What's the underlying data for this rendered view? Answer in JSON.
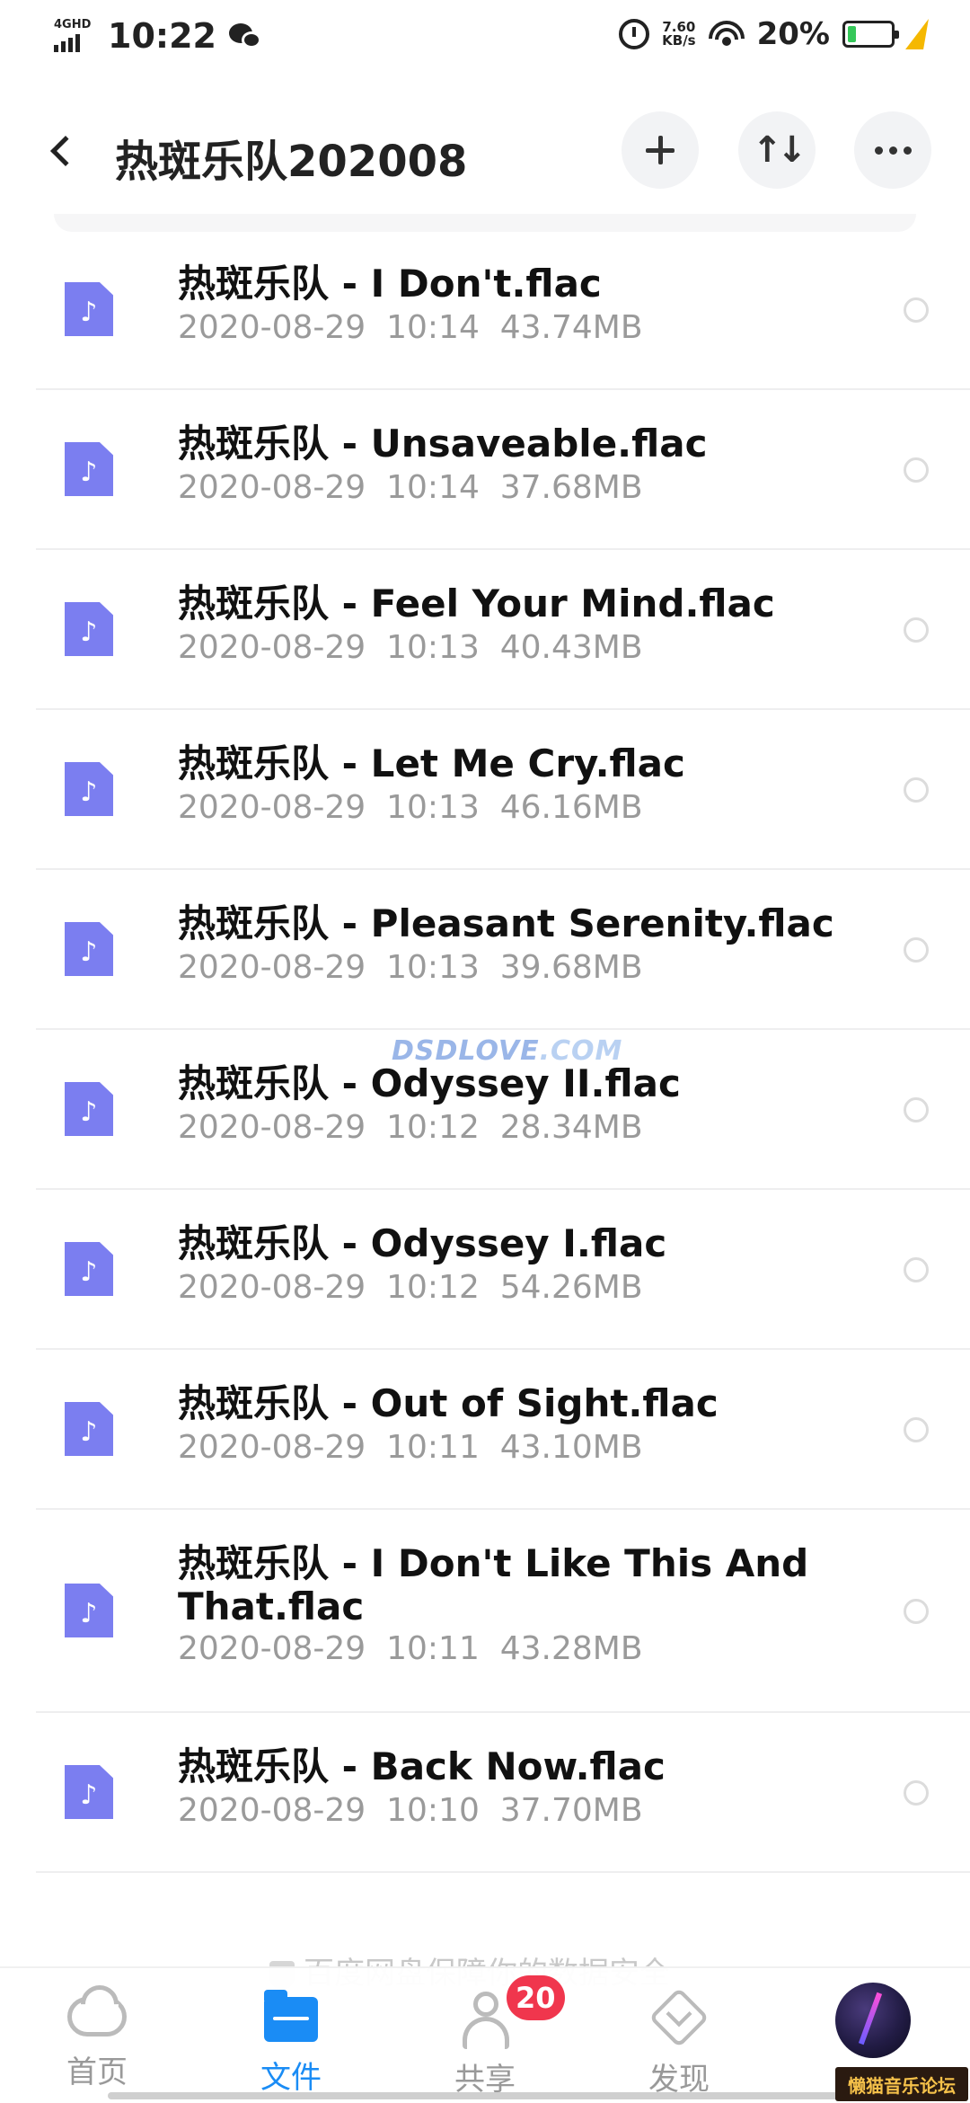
{
  "status_bar": {
    "network": "4GHD",
    "time": "10:22",
    "speed_value": "7.60",
    "speed_unit": "KB/s",
    "battery_percent": "20%",
    "battery_level": 0.2,
    "icons": [
      "wechat-icon",
      "alarm-icon",
      "wifi-icon",
      "battery-icon",
      "charging-icon"
    ]
  },
  "header": {
    "back_icon": "chevron-left-icon",
    "title": "热斑乐队202008",
    "add_icon": "plus-icon",
    "sort_icon": "sort-icon",
    "sort_glyph": "↑↓",
    "more_icon": "more-icon"
  },
  "files": [
    {
      "name": "热斑乐队 - I Don't.flac",
      "date": "2020-08-29",
      "time": "10:14",
      "size": "43.74MB"
    },
    {
      "name": "热斑乐队 - Unsaveable.flac",
      "date": "2020-08-29",
      "time": "10:14",
      "size": "37.68MB"
    },
    {
      "name": "热斑乐队 - Feel Your Mind.flac",
      "date": "2020-08-29",
      "time": "10:13",
      "size": "40.43MB"
    },
    {
      "name": "热斑乐队 - Let Me Cry.flac",
      "date": "2020-08-29",
      "time": "10:13",
      "size": "46.16MB"
    },
    {
      "name": "热斑乐队 - Pleasant Serenity.flac",
      "date": "2020-08-29",
      "time": "10:13",
      "size": "39.68MB"
    },
    {
      "name": "热斑乐队 - Odyssey II.flac",
      "date": "2020-08-29",
      "time": "10:12",
      "size": "28.34MB"
    },
    {
      "name": "热斑乐队 - Odyssey I.flac",
      "date": "2020-08-29",
      "time": "10:12",
      "size": "54.26MB"
    },
    {
      "name": "热斑乐队 - Out of Sight.flac",
      "date": "2020-08-29",
      "time": "10:11",
      "size": "43.10MB"
    },
    {
      "name": "热斑乐队 - I Don't Like This And That.flac",
      "date": "2020-08-29",
      "time": "10:11",
      "size": "43.28MB"
    },
    {
      "name": "热斑乐队 - Back Now.flac",
      "date": "2020-08-29",
      "time": "10:10",
      "size": "37.70MB"
    }
  ],
  "file_icon": "music-file-icon",
  "file_icon_glyph": "♪",
  "watermark": {
    "part1": "DSDLOVE",
    "part2": ".COM"
  },
  "safety_note": "百度网盘保障你的数据安全",
  "bottom_nav": {
    "items": [
      {
        "label": "首页",
        "icon": "cloud-icon",
        "active": false
      },
      {
        "label": "文件",
        "icon": "folder-icon",
        "active": true
      },
      {
        "label": "共享",
        "icon": "people-icon",
        "active": false
      },
      {
        "label": "发现",
        "icon": "discover-icon",
        "active": false
      }
    ],
    "share_badge": "20",
    "avatar_icon": "avatar-icon"
  },
  "forum_tag": "懒猫音乐论坛",
  "colors": {
    "accent": "#1a8cf5",
    "file_icon": "#7b7ef0",
    "badge": "#f0364d",
    "meta_text": "#9a9a9a"
  }
}
